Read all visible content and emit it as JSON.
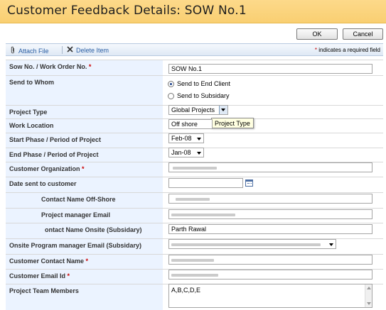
{
  "page": {
    "title": "Customer Feedback Details: SOW No.1"
  },
  "buttons": {
    "ok": "OK",
    "cancel": "Cancel"
  },
  "toolbar": {
    "attach_file": "Attach File",
    "delete_item": "Delete Item",
    "required_note": "indicates a required field",
    "required_star": "*"
  },
  "form": {
    "sow_no": {
      "label": "Sow No. / Work Order No.",
      "value": "SOW No.1",
      "required": true
    },
    "send_to_whom": {
      "label": "Send to Whom",
      "options": [
        "Send to End Client",
        "Send to Subsidary"
      ],
      "selected": "Send to End Client"
    },
    "project_type": {
      "label": "Project Type",
      "value": "Global Projects",
      "tooltip": "Project Type"
    },
    "work_location": {
      "label": "Work Location",
      "value": "Off shore"
    },
    "start_phase": {
      "label": "Start Phase / Period of Project",
      "value": "Feb-08"
    },
    "end_phase": {
      "label": "End Phase / Period of Project",
      "value": "Jan-08"
    },
    "customer_org": {
      "label": "Customer Organization",
      "required": true
    },
    "date_sent": {
      "label": "Date sent to customer",
      "value": ""
    },
    "contact_offshore": {
      "label": "Contact Name Off-Shore"
    },
    "pm_email": {
      "label": "Project manager Email"
    },
    "contact_onsite": {
      "label": "ontact Name Onsite (Subsidary)",
      "value": "Parth Rawal"
    },
    "onsite_pm_email": {
      "label": "Onsite Program manager Email (Subsidary)"
    },
    "customer_contact": {
      "label": "Customer Contact Name",
      "required": true
    },
    "customer_email": {
      "label": "Customer Email Id",
      "required": true
    },
    "team_members": {
      "label": "Project Team Members",
      "value": "A,B,C,D,E"
    }
  },
  "colors": {
    "header_bg": "#f9cf72",
    "label_bg": "#ebf3ff",
    "link": "#2a5ea3",
    "required": "#cc0000"
  }
}
